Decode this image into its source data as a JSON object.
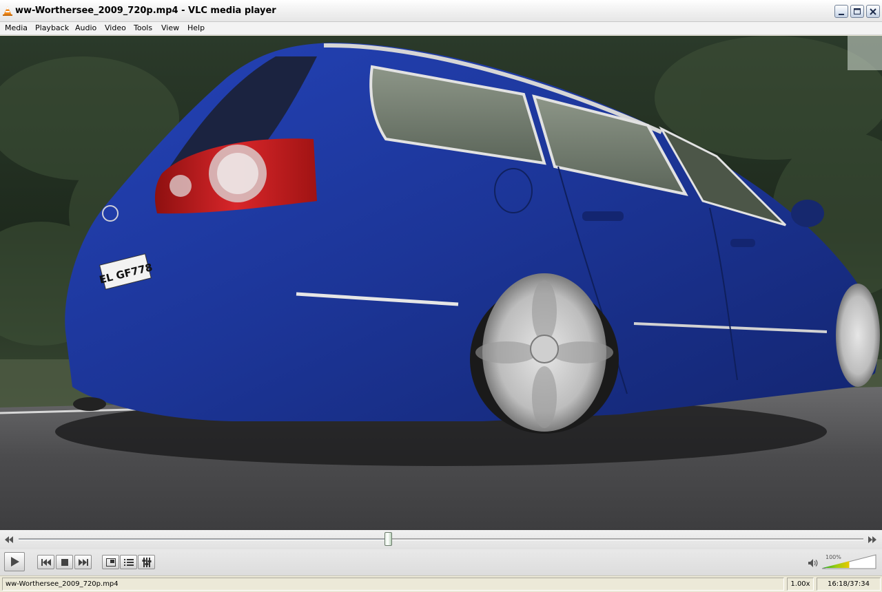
{
  "window": {
    "title": "ww-Worthersee_2009_720p.mp4 - VLC media player",
    "controls": [
      "minimize",
      "maximize",
      "close"
    ]
  },
  "menu": {
    "items": [
      {
        "label": "Media"
      },
      {
        "label": "Playback"
      },
      {
        "label": "Audio"
      },
      {
        "label": "Video"
      },
      {
        "label": "Tools"
      },
      {
        "label": "View"
      },
      {
        "label": "Help"
      }
    ]
  },
  "video": {
    "license_plate": "EL GF778"
  },
  "seek": {
    "progress": 0.437
  },
  "controls": {
    "buttons": [
      "play-icon",
      "previous-icon",
      "stop-icon",
      "next-icon",
      "fullscreen-icon",
      "playlist-icon",
      "extended-settings-icon"
    ]
  },
  "volume": {
    "label": "100%",
    "level": 1.0
  },
  "status": {
    "filename": "ww-Worthersee_2009_720p.mp4",
    "rate": "1.00x",
    "time": "16:18/37:34"
  },
  "colors": {
    "car_body": "#1e3a9e",
    "tail_light": "#c81e1e",
    "road": "#4a4a4c",
    "volume_low": "#22aa22",
    "volume_high": "#e8c800"
  }
}
